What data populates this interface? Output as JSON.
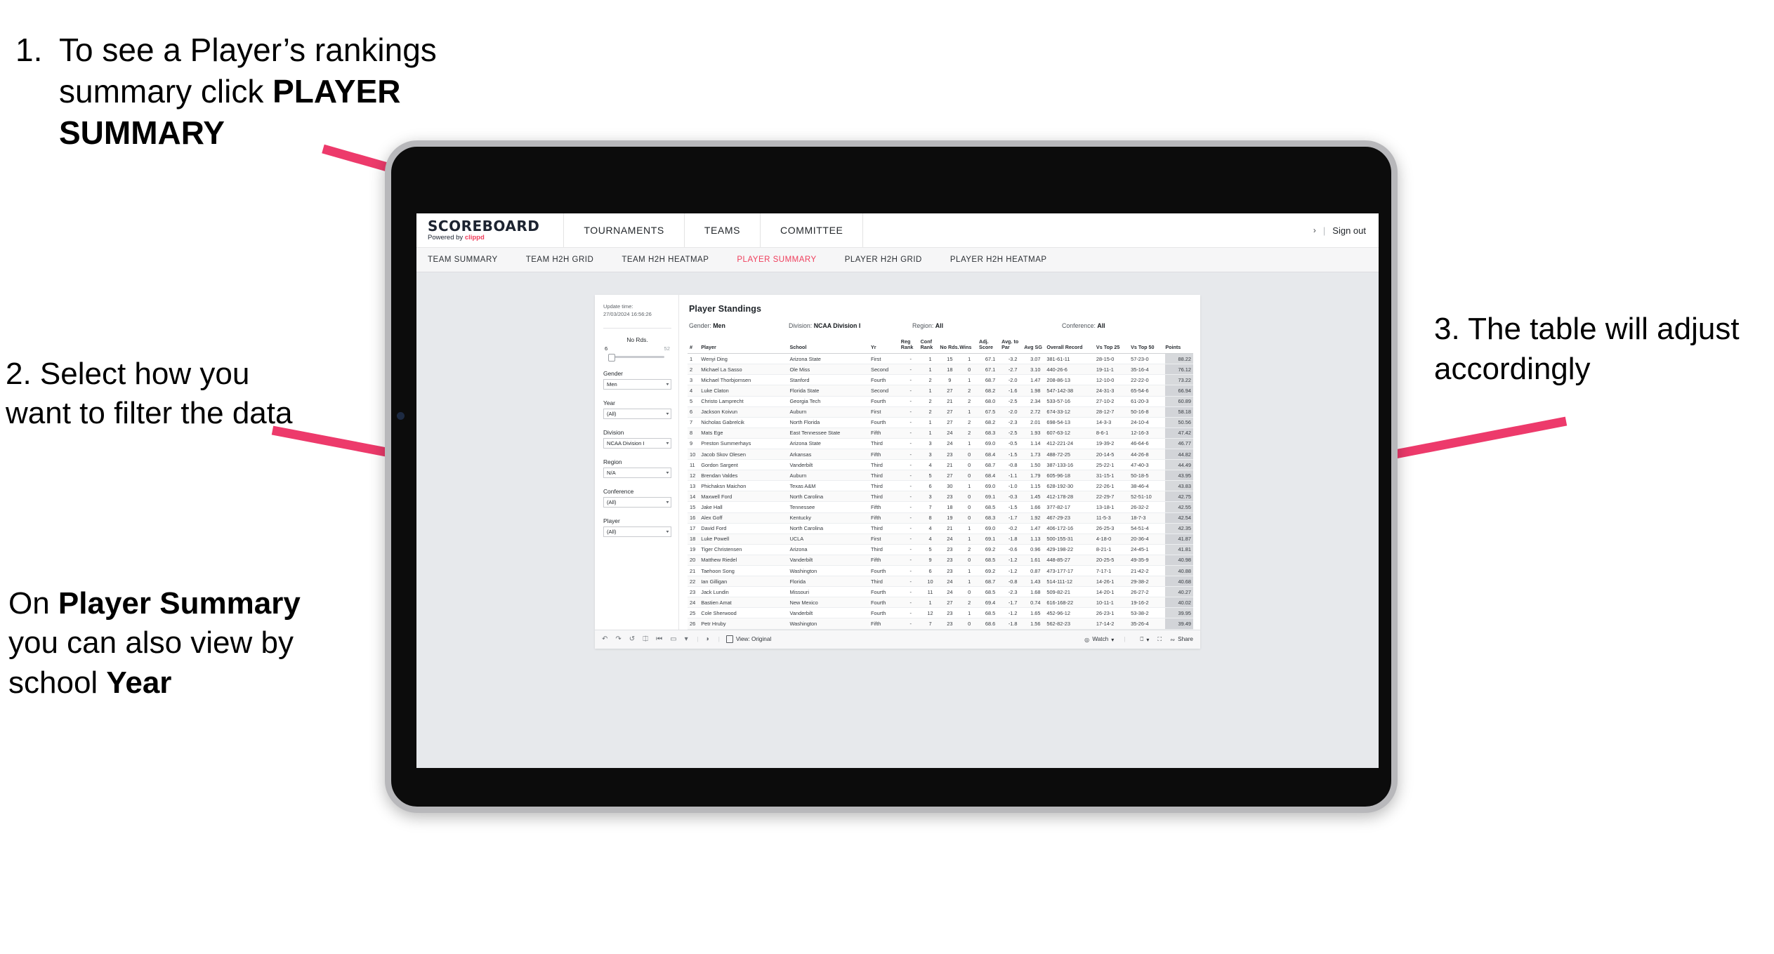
{
  "annotations": {
    "step1": {
      "number": "1.",
      "text_a": "To see a Player’s rankings summary click ",
      "bold_a": "PLAYER SUMMARY"
    },
    "step2": {
      "text": "2. Select how you want to filter the data"
    },
    "step2b": {
      "a": "On ",
      "b1": "Player Summary",
      "c": " you can also view by school ",
      "b2": "Year"
    },
    "step3": {
      "text": "3. The table will adjust accordingly"
    },
    "arrow_color": "#ED3A6B"
  },
  "app": {
    "logo": {
      "word": "SCOREBOARD",
      "powered": "Powered by ",
      "brand": "clippd"
    },
    "topnav": [
      "TOURNAMENTS",
      "TEAMS",
      "COMMITTEE"
    ],
    "top_right": {
      "chevron": "›",
      "separator": "|",
      "sign_out": "Sign out"
    },
    "subnav": [
      {
        "label": "TEAM SUMMARY",
        "active": false
      },
      {
        "label": "TEAM H2H GRID",
        "active": false
      },
      {
        "label": "TEAM H2H HEATMAP",
        "active": false
      },
      {
        "label": "PLAYER SUMMARY",
        "active": true
      },
      {
        "label": "PLAYER H2H GRID",
        "active": false
      },
      {
        "label": "PLAYER H2H HEATMAP",
        "active": false
      }
    ],
    "accent": "#ef3e5c"
  },
  "filters": {
    "update_label": "Update time:",
    "update_value": "27/03/2024 16:56:26",
    "slider": {
      "label": "No Rds.",
      "min": "6",
      "max": "52"
    },
    "selects": [
      {
        "label": "Gender",
        "value": "Men"
      },
      {
        "label": "Year",
        "value": "(All)"
      },
      {
        "label": "Division",
        "value": "NCAA Division I"
      },
      {
        "label": "Region",
        "value": "N/A"
      },
      {
        "label": "Conference",
        "value": "(All)"
      },
      {
        "label": "Player",
        "value": "(All)"
      }
    ],
    "caret": "▾"
  },
  "dashboard": {
    "title": "Player Standings",
    "filter_summary": [
      {
        "label": "Gender: ",
        "value": "Men"
      },
      {
        "label": "Division: ",
        "value": "NCAA Division I"
      },
      {
        "label": "Region: ",
        "value": "All"
      },
      {
        "label": "Conference: ",
        "value": "All"
      }
    ],
    "columns": [
      "#",
      "Player",
      "School",
      "Yr",
      "Reg Rank",
      "Conf Rank",
      "No Rds.",
      "Wins",
      "Adj. Score",
      "Avg. to Par",
      "Avg SG",
      "Overall Record",
      "Vs Top 25",
      "Vs Top 50",
      "Points"
    ],
    "rows": [
      [
        "1",
        "Wenyi Ding",
        "Arizona State",
        "First",
        "-",
        "1",
        "15",
        "1",
        "67.1",
        "-3.2",
        "3.07",
        "381-61-11",
        "28-15-0",
        "57-23-0",
        "88.22"
      ],
      [
        "2",
        "Michael La Sasso",
        "Ole Miss",
        "Second",
        "-",
        "1",
        "18",
        "0",
        "67.1",
        "-2.7",
        "3.10",
        "440-26-6",
        "19-11-1",
        "35-16-4",
        "76.12"
      ],
      [
        "3",
        "Michael Thorbjornsen",
        "Stanford",
        "Fourth",
        "-",
        "2",
        "9",
        "1",
        "68.7",
        "-2.0",
        "1.47",
        "208-86-13",
        "12-10-0",
        "22-22-0",
        "73.22"
      ],
      [
        "4",
        "Luke Claton",
        "Florida State",
        "Second",
        "-",
        "1",
        "27",
        "2",
        "68.2",
        "-1.6",
        "1.98",
        "547-142-38",
        "24-31-3",
        "65-54-6",
        "66.94"
      ],
      [
        "5",
        "Christo Lamprecht",
        "Georgia Tech",
        "Fourth",
        "-",
        "2",
        "21",
        "2",
        "68.0",
        "-2.5",
        "2.34",
        "533-57-16",
        "27-10-2",
        "61-20-3",
        "60.89"
      ],
      [
        "6",
        "Jackson Koivun",
        "Auburn",
        "First",
        "-",
        "2",
        "27",
        "1",
        "67.5",
        "-2.0",
        "2.72",
        "674-33-12",
        "28-12-7",
        "50-16-8",
        "58.18"
      ],
      [
        "7",
        "Nicholas Gabrelcik",
        "North Florida",
        "Fourth",
        "-",
        "1",
        "27",
        "2",
        "68.2",
        "-2.3",
        "2.01",
        "698-54-13",
        "14-3-3",
        "24-10-4",
        "50.56"
      ],
      [
        "8",
        "Mats Ege",
        "East Tennessee State",
        "Fifth",
        "-",
        "1",
        "24",
        "2",
        "68.3",
        "-2.5",
        "1.93",
        "607-63-12",
        "8-6-1",
        "12-16-3",
        "47.42"
      ],
      [
        "9",
        "Preston Summerhays",
        "Arizona State",
        "Third",
        "-",
        "3",
        "24",
        "1",
        "69.0",
        "-0.5",
        "1.14",
        "412-221-24",
        "19-39-2",
        "46-64-6",
        "46.77"
      ],
      [
        "10",
        "Jacob Skov Olesen",
        "Arkansas",
        "Fifth",
        "-",
        "3",
        "23",
        "0",
        "68.4",
        "-1.5",
        "1.73",
        "488-72-25",
        "20-14-5",
        "44-26-8",
        "44.82"
      ],
      [
        "11",
        "Gordon Sargent",
        "Vanderbilt",
        "Third",
        "-",
        "4",
        "21",
        "0",
        "68.7",
        "-0.8",
        "1.50",
        "387-133-16",
        "25-22-1",
        "47-40-3",
        "44.49"
      ],
      [
        "12",
        "Brendan Valdes",
        "Auburn",
        "Third",
        "-",
        "5",
        "27",
        "0",
        "68.4",
        "-1.1",
        "1.79",
        "605-96-18",
        "31-15-1",
        "50-18-5",
        "43.95"
      ],
      [
        "13",
        "Phichaksn Maichon",
        "Texas A&M",
        "Third",
        "-",
        "6",
        "30",
        "1",
        "69.0",
        "-1.0",
        "1.15",
        "628-192-30",
        "22-26-1",
        "38-46-4",
        "43.83"
      ],
      [
        "14",
        "Maxwell Ford",
        "North Carolina",
        "Third",
        "-",
        "3",
        "23",
        "0",
        "69.1",
        "-0.3",
        "1.45",
        "412-178-28",
        "22-29-7",
        "52-51-10",
        "42.75"
      ],
      [
        "15",
        "Jake Hall",
        "Tennessee",
        "Fifth",
        "-",
        "7",
        "18",
        "0",
        "68.5",
        "-1.5",
        "1.66",
        "377-82-17",
        "13-18-1",
        "26-32-2",
        "42.55"
      ],
      [
        "16",
        "Alex Goff",
        "Kentucky",
        "Fifth",
        "-",
        "8",
        "19",
        "0",
        "68.3",
        "-1.7",
        "1.92",
        "467-29-23",
        "11-5-3",
        "18-7-3",
        "42.54"
      ],
      [
        "17",
        "David Ford",
        "North Carolina",
        "Third",
        "-",
        "4",
        "21",
        "1",
        "69.0",
        "-0.2",
        "1.47",
        "406-172-16",
        "26-25-3",
        "54-51-4",
        "42.35"
      ],
      [
        "18",
        "Luke Powell",
        "UCLA",
        "First",
        "-",
        "4",
        "24",
        "1",
        "69.1",
        "-1.8",
        "1.13",
        "500-155-31",
        "4-18-0",
        "20-36-4",
        "41.87"
      ],
      [
        "19",
        "Tiger Christensen",
        "Arizona",
        "Third",
        "-",
        "5",
        "23",
        "2",
        "69.2",
        "-0.6",
        "0.96",
        "429-198-22",
        "8-21-1",
        "24-45-1",
        "41.81"
      ],
      [
        "20",
        "Matthew Riedel",
        "Vanderbilt",
        "Fifth",
        "-",
        "9",
        "23",
        "0",
        "68.5",
        "-1.2",
        "1.61",
        "448-85-27",
        "20-25-5",
        "49-35-9",
        "40.98"
      ],
      [
        "21",
        "Taehoon Song",
        "Washington",
        "Fourth",
        "-",
        "6",
        "23",
        "1",
        "69.2",
        "-1.2",
        "0.87",
        "473-177-17",
        "7-17-1",
        "21-42-2",
        "40.88"
      ],
      [
        "22",
        "Ian Gilligan",
        "Florida",
        "Third",
        "-",
        "10",
        "24",
        "1",
        "68.7",
        "-0.8",
        "1.43",
        "514-111-12",
        "14-26-1",
        "29-38-2",
        "40.68"
      ],
      [
        "23",
        "Jack Lundin",
        "Missouri",
        "Fourth",
        "-",
        "11",
        "24",
        "0",
        "68.5",
        "-2.3",
        "1.68",
        "509-82-21",
        "14-20-1",
        "26-27-2",
        "40.27"
      ],
      [
        "24",
        "Bastien Amat",
        "New Mexico",
        "Fourth",
        "-",
        "1",
        "27",
        "2",
        "69.4",
        "-1.7",
        "0.74",
        "616-168-22",
        "10-11-1",
        "19-16-2",
        "40.02"
      ],
      [
        "25",
        "Cole Sherwood",
        "Vanderbilt",
        "Fourth",
        "-",
        "12",
        "23",
        "1",
        "68.5",
        "-1.2",
        "1.65",
        "452-96-12",
        "26-23-1",
        "53-38-2",
        "39.95"
      ],
      [
        "26",
        "Petr Hruby",
        "Washington",
        "Fifth",
        "-",
        "7",
        "23",
        "0",
        "68.6",
        "-1.8",
        "1.56",
        "562-82-23",
        "17-14-2",
        "35-26-4",
        "39.49"
      ]
    ]
  },
  "toolbar": {
    "icons": [
      "undo-icon",
      "redo-icon",
      "revert-icon",
      "refresh-data-icon",
      "pause-icon",
      "custom-view-icon",
      "caret-icon"
    ],
    "glyphs": [
      "↶",
      "↷",
      "↺",
      "⥁",
      "⏸",
      "▭",
      "▾",
      "◔"
    ],
    "view_label": "View: Original",
    "watch_label": "Watch",
    "share_label": "Share",
    "caret": "▾"
  }
}
